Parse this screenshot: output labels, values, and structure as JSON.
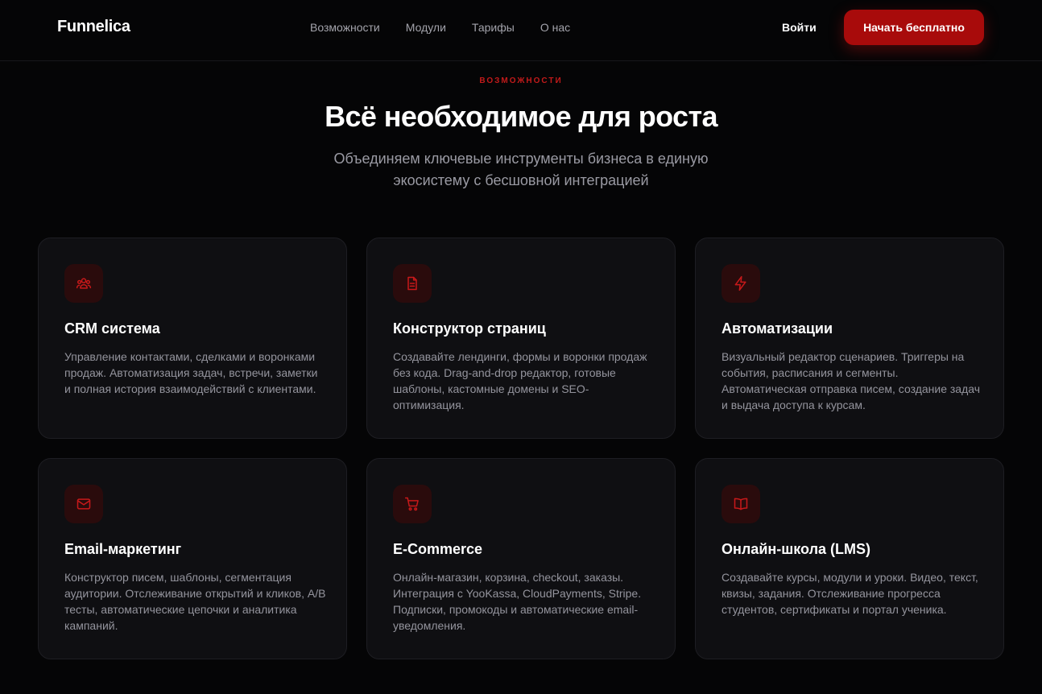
{
  "header": {
    "logo": "Funnelica",
    "nav": [
      "Возможности",
      "Модули",
      "Тарифы",
      "О нас"
    ],
    "login_label": "Войти",
    "cta_label": "Начать бесплатно"
  },
  "hero": {
    "eyebrow": "ВОЗМОЖНОСТИ",
    "title": "Всё необходимое для роста",
    "subtitle": "Объединяем ключевые инструменты бизнеса в единую экосистему с бесшовной интеграцией"
  },
  "features": [
    {
      "icon": "users-icon",
      "title": "CRM система",
      "desc": "Управление контактами, сделками и воронками продаж. Автоматизация задач, встречи, заметки и полная история взаимодействий с клиентами."
    },
    {
      "icon": "document-icon",
      "title": "Конструктор страниц",
      "desc": "Создавайте лендинги, формы и воронки продаж без кода. Drag-and-drop редактор, готовые шаблоны, кастомные домены и SEO-оптимизация."
    },
    {
      "icon": "lightning-icon",
      "title": "Автоматизации",
      "desc": "Визуальный редактор сценариев. Триггеры на события, расписания и сегменты. Автоматическая отправка писем, создание задач и выдача доступа к курсам."
    },
    {
      "icon": "mail-icon",
      "title": "Email-маркетинг",
      "desc": "Конструктор писем, шаблоны, сегментация аудитории. Отслеживание открытий и кликов, A/B тесты, автоматические цепочки и аналитика кампаний."
    },
    {
      "icon": "cart-icon",
      "title": "E-Commerce",
      "desc": "Онлайн-магазин, корзина, checkout, заказы. Интеграция с YooKassa, CloudPayments, Stripe. Подписки, промокоды и автоматические email-уведомления."
    },
    {
      "icon": "book-icon",
      "title": "Онлайн-школа (LMS)",
      "desc": "Создавайте курсы, модули и уроки. Видео, текст, квизы, задания. Отслеживание прогресса студентов, сертификаты и портал ученика."
    }
  ],
  "colors": {
    "accent": "#a80b0b",
    "icon_stroke": "#c8191a",
    "card_bg": "#0f0f12",
    "page_bg": "#050506"
  }
}
